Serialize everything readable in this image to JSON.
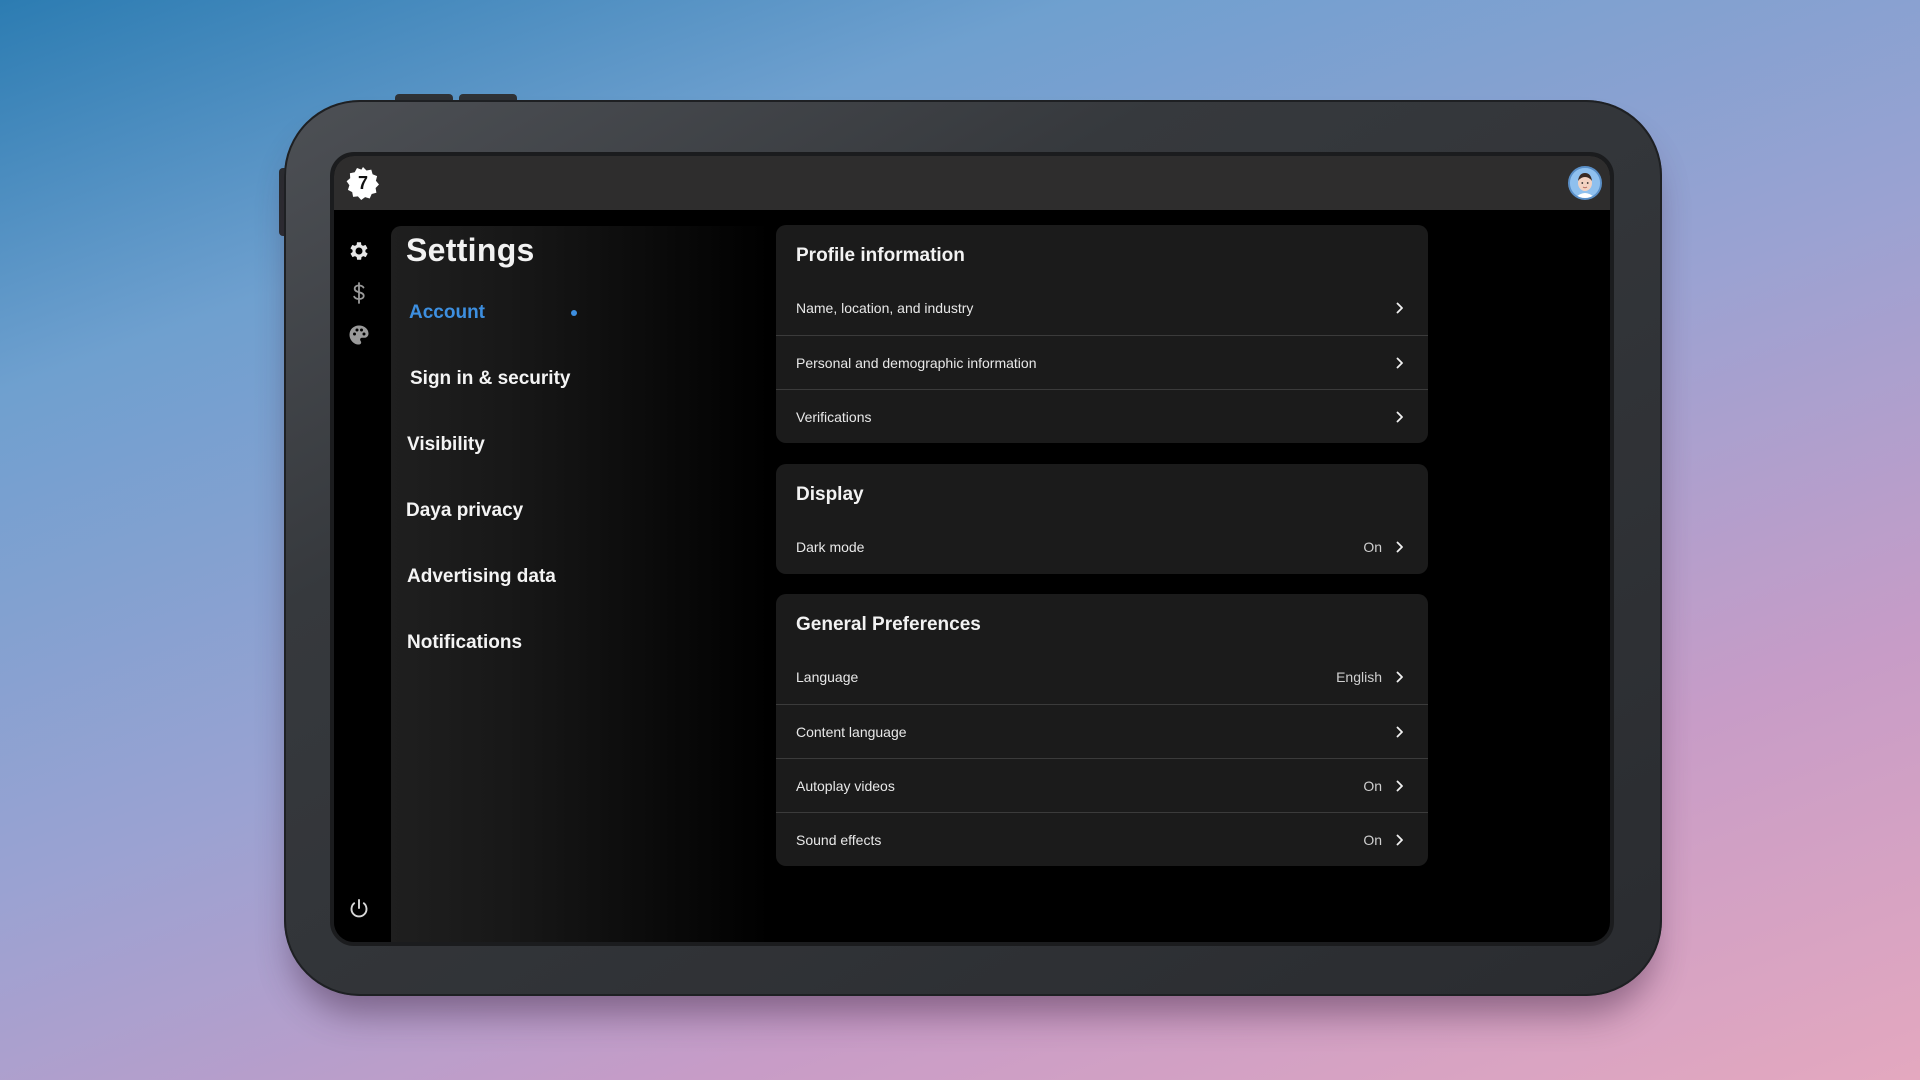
{
  "app": {
    "logo_number": "7"
  },
  "settings": {
    "title": "Settings",
    "nav": [
      {
        "label": "Account",
        "active": true
      },
      {
        "label": "Sign in & security",
        "active": false
      },
      {
        "label": "Visibility",
        "active": false
      },
      {
        "label": "Daya privacy",
        "active": false
      },
      {
        "label": "Advertising data",
        "active": false
      },
      {
        "label": "Notifications",
        "active": false
      }
    ]
  },
  "rail": {
    "icons": [
      "gear-icon",
      "dollar-icon",
      "palette-icon",
      "power-icon"
    ]
  },
  "cards": [
    {
      "title": "Profile information",
      "rows": [
        {
          "label": "Name, location, and industry",
          "value": ""
        },
        {
          "label": "Personal and demographic information",
          "value": ""
        },
        {
          "label": "Verifications",
          "value": ""
        }
      ]
    },
    {
      "title": "Display",
      "rows": [
        {
          "label": "Dark mode",
          "value": "On"
        }
      ]
    },
    {
      "title": "General Preferences",
      "rows": [
        {
          "label": "Language",
          "value": "English"
        },
        {
          "label": "Content language",
          "value": ""
        },
        {
          "label": "Autoplay videos",
          "value": "On"
        },
        {
          "label": "Sound effects",
          "value": "On"
        }
      ]
    }
  ],
  "colors": {
    "accent": "#3d8fe0",
    "card_bg": "#1b1b1b",
    "topbar_bg": "#2e2d2d"
  }
}
